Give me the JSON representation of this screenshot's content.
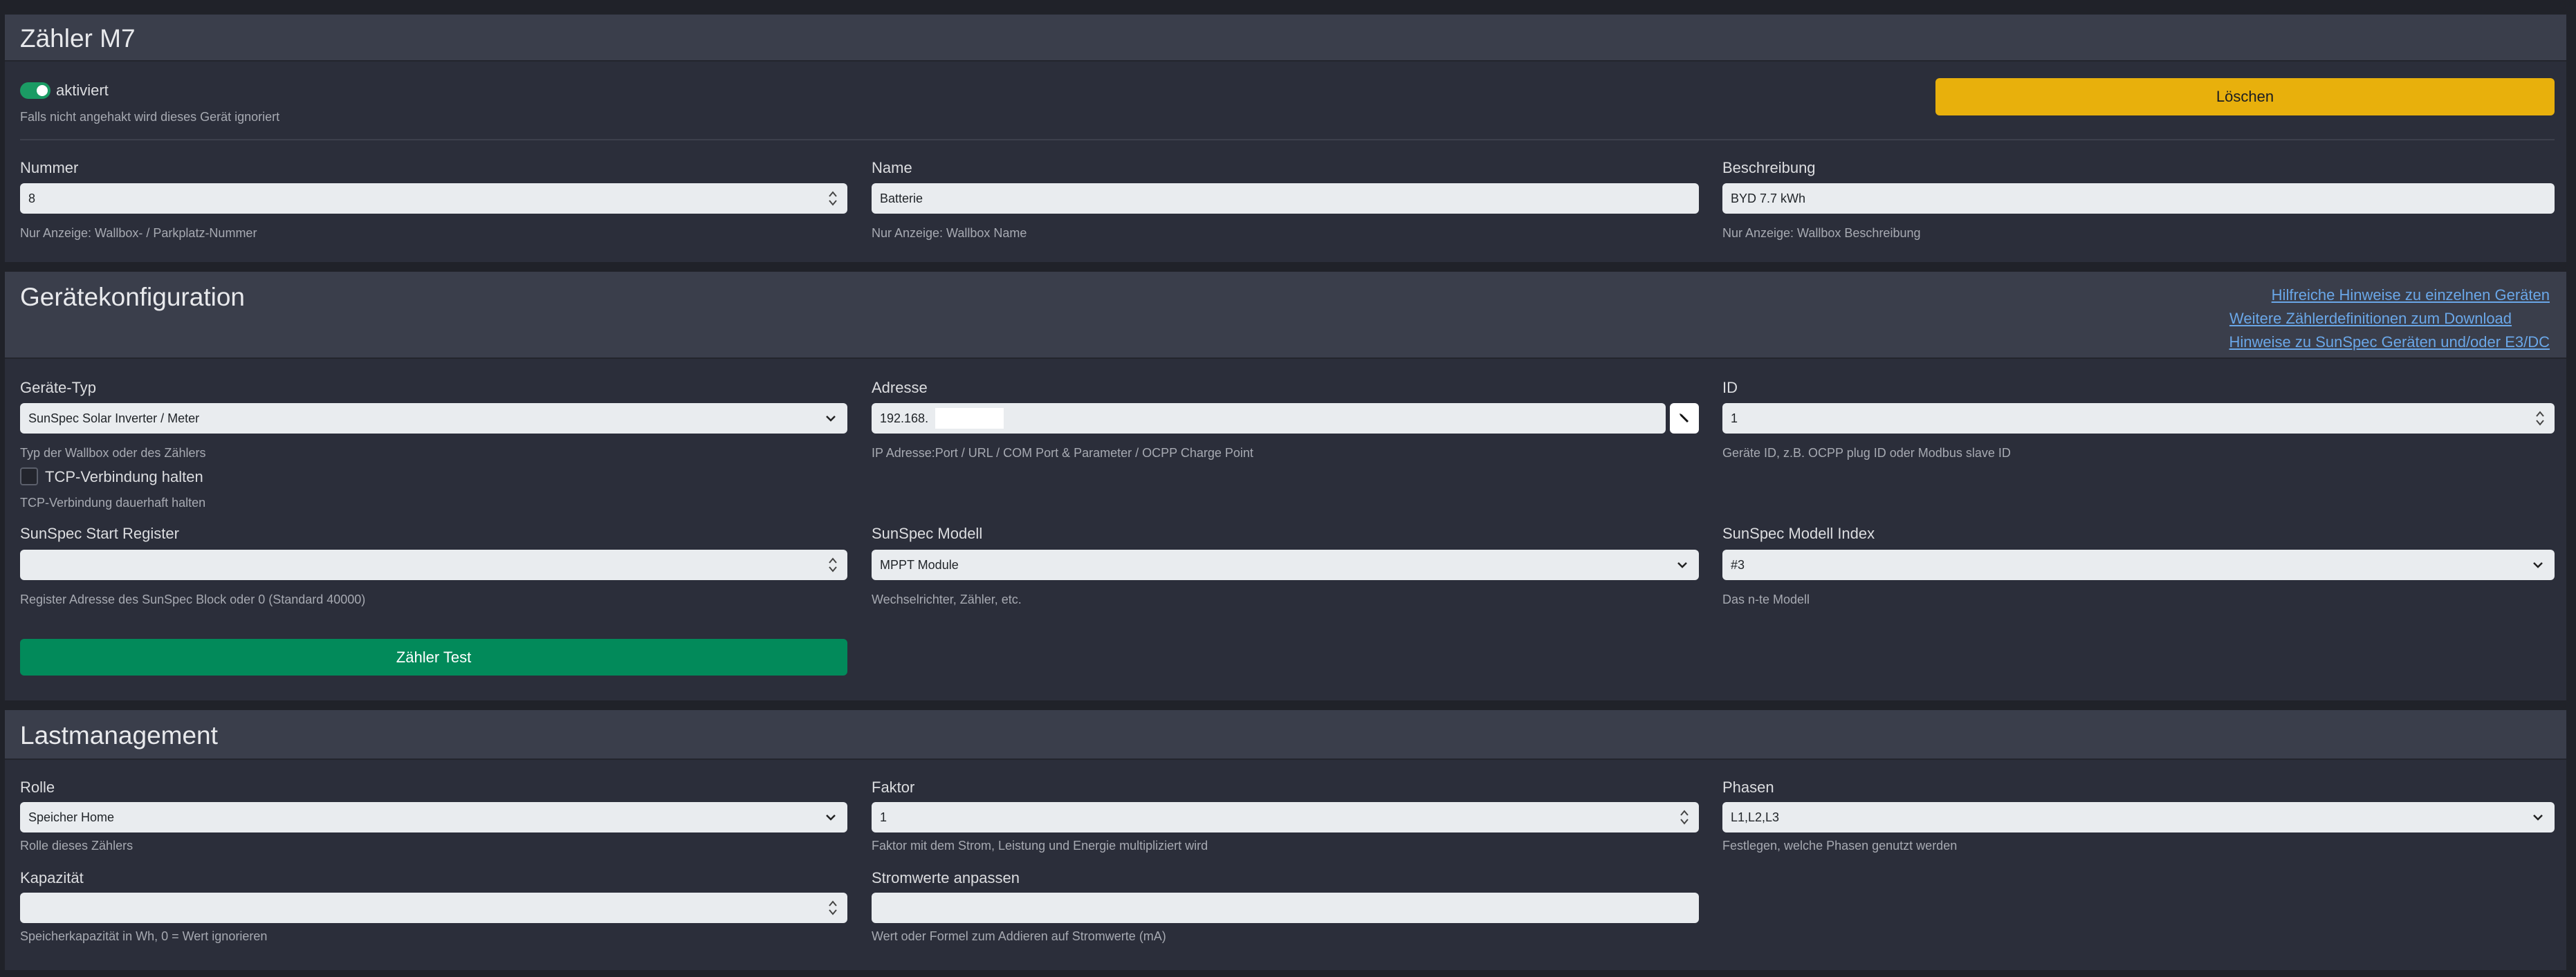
{
  "meter_panel": {
    "title": "Zähler M7",
    "enabled_label": "aktiviert",
    "enabled_help": "Falls nicht angehakt wird dieses Gerät ignoriert",
    "delete_label": "Löschen",
    "number": {
      "label": "Nummer",
      "value": "8",
      "help": "Nur Anzeige: Wallbox- / Parkplatz-Nummer"
    },
    "name": {
      "label": "Name",
      "value": "Batterie",
      "help": "Nur Anzeige: Wallbox Name"
    },
    "description": {
      "label": "Beschreibung",
      "value": "BYD 7.7 kWh",
      "help": "Nur Anzeige: Wallbox Beschreibung"
    }
  },
  "device_panel": {
    "title": "Gerätekonfiguration",
    "links": [
      "Hilfreiche Hinweise zu einzelnen Geräten",
      "Weitere Zählerdefinitionen zum Download",
      "Hinweise zu SunSpec Geräten und/oder E3/DC"
    ],
    "device_type": {
      "label": "Geräte-Typ",
      "value": "SunSpec Solar Inverter / Meter",
      "help": "Typ der Wallbox oder des Zählers"
    },
    "address": {
      "label": "Adresse",
      "value": "192.168.",
      "help": "IP Adresse:Port / URL / COM Port & Parameter / OCPP Charge Point"
    },
    "id": {
      "label": "ID",
      "value": "1",
      "help": "Geräte ID, z.B. OCPP plug ID oder Modbus slave ID"
    },
    "tcp_keep": {
      "label": "TCP-Verbindung halten",
      "help": "TCP-Verbindung dauerhaft halten"
    },
    "start_register": {
      "label": "SunSpec Start Register",
      "value": "",
      "help": "Register Adresse des SunSpec Block oder 0 (Standard 40000)"
    },
    "model": {
      "label": "SunSpec Modell",
      "value": "MPPT Module",
      "help": "Wechselrichter, Zähler, etc."
    },
    "model_index": {
      "label": "SunSpec Modell Index",
      "value": "#3",
      "help": "Das n-te Modell"
    },
    "test_label": "Zähler Test"
  },
  "load_panel": {
    "title": "Lastmanagement",
    "role": {
      "label": "Rolle",
      "value": "Speicher Home",
      "help": "Rolle dieses Zählers"
    },
    "factor": {
      "label": "Faktor",
      "value": "1",
      "help": "Faktor mit dem Strom, Leistung und Energie multipliziert wird"
    },
    "phases": {
      "label": "Phasen",
      "value": "L1,L2,L3",
      "help": "Festlegen, welche Phasen genutzt werden"
    },
    "capacity": {
      "label": "Kapazität",
      "value": "",
      "help": "Speicherkapazität in Wh, 0 = Wert ignorieren"
    },
    "current_adjust": {
      "label": "Stromwerte anpassen",
      "value": "",
      "help": "Wert oder Formel zum Addieren auf Stromwerte (mA)"
    }
  }
}
